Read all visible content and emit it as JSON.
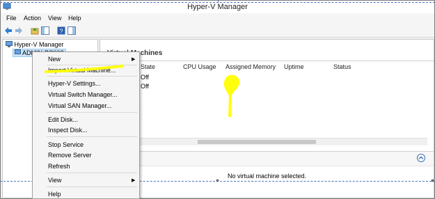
{
  "window": {
    "title": "Hyper-V Manager"
  },
  "menubar": {
    "items": [
      "File",
      "Action",
      "View",
      "Help"
    ]
  },
  "toolbar": {
    "icons": [
      "back-arrow-icon",
      "forward-arrow-icon",
      "folder-up-icon",
      "show-hide-tree-icon",
      "help-icon",
      "action-pane-icon"
    ]
  },
  "tree": {
    "root_label": "Hyper-V Manager",
    "server_label": "ADMIN-PC002"
  },
  "vm_pane": {
    "title": "Virtual Machines",
    "columns": [
      "State",
      "CPU Usage",
      "Assigned Memory",
      "Uptime",
      "Status"
    ],
    "rows": [
      {
        "state": "Off"
      },
      {
        "state": "Off"
      }
    ]
  },
  "details_pane": {
    "title_fragment": "s",
    "empty_message": "No virtual machine selected."
  },
  "context_menu": {
    "items": [
      {
        "label": "New",
        "submenu": true
      },
      {
        "label": "Import Virtual Machine...",
        "highlighted": true
      },
      {
        "label": "Hyper-V Settings..."
      },
      {
        "label": "Virtual Switch Manager..."
      },
      {
        "label": "Virtual SAN Manager..."
      },
      {
        "label": "Edit Disk..."
      },
      {
        "label": "Inspect Disk..."
      },
      {
        "label": "Stop Service"
      },
      {
        "label": "Remove Server"
      },
      {
        "label": "Refresh"
      },
      {
        "label": "View",
        "submenu": true
      },
      {
        "label": "Help"
      }
    ]
  },
  "colors": {
    "annotation_highlight": "#ffff00",
    "selection": "#cce4f7"
  }
}
